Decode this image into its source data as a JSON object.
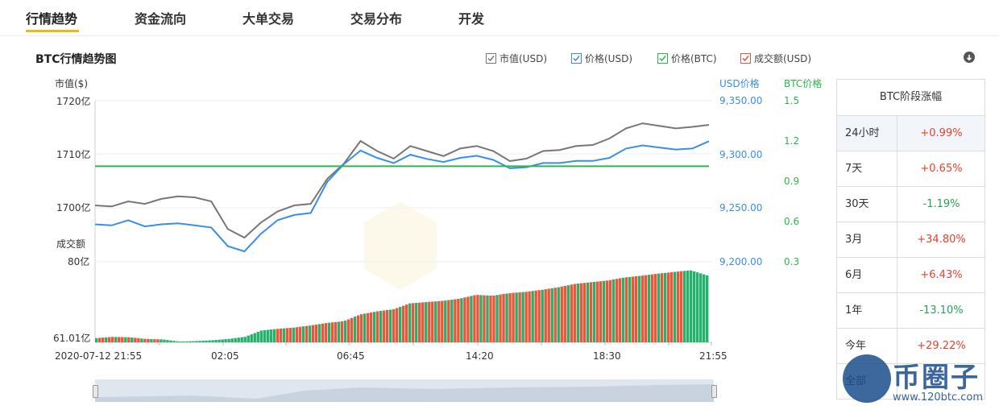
{
  "tabs": [
    {
      "label": "行情趋势",
      "active": true
    },
    {
      "label": "资金流向",
      "active": false
    },
    {
      "label": "大单交易",
      "active": false
    },
    {
      "label": "交易分布",
      "active": false
    },
    {
      "label": "开发",
      "active": false
    }
  ],
  "chart_title": "BTC行情趋势图",
  "legend": [
    {
      "label": "市值(USD)",
      "color": "#777777",
      "checked": true
    },
    {
      "label": "价格(USD)",
      "color": "#3a8ee6",
      "checked": true
    },
    {
      "label": "价格(BTC)",
      "color": "#2ab84a",
      "checked": true
    },
    {
      "label": "成交额(USD)",
      "color": "#e8573a",
      "checked": true
    }
  ],
  "download_icon": "download-icon",
  "axes": {
    "left_label": "市值($)",
    "usd_label": "USD价格",
    "btc_label": "BTC价格",
    "volume_label": "成交额"
  },
  "chart_data": {
    "type": "line",
    "x": [
      "2020-07-12 21:55",
      "02:05",
      "06:45",
      "14:20",
      "18:30",
      "21:55"
    ],
    "x_tick_labels": [
      "2020-07-12 21:55",
      "02:05",
      "06:45",
      "14:20",
      "18:30",
      "21:55"
    ],
    "left_ticks": [
      "1720亿",
      "1710亿",
      "1700亿"
    ],
    "usd_ticks": [
      "9,350.00",
      "9,300.00",
      "9,250.00",
      "9,200.00"
    ],
    "btc_ticks": [
      "1.5",
      "1.2",
      "0.9",
      "0.6",
      "0.3"
    ],
    "volume_ticks": [
      "80亿",
      "61.01亿"
    ],
    "ylim_market_cap": [
      1690,
      1720
    ],
    "ylim_usd": [
      9200,
      9350
    ],
    "ylim_btc": [
      0.3,
      1.5
    ],
    "ylim_volume": [
      61.01,
      80
    ],
    "series": [
      {
        "name": "市值(USD)",
        "color": "#777777",
        "values": [
          1701.2,
          1701.0,
          1702.0,
          1701.5,
          1702.5,
          1703.0,
          1702.8,
          1702.0,
          1696.5,
          1694.8,
          1697.8,
          1700.0,
          1701.2,
          1701.5,
          1706.5,
          1709.5,
          1714.0,
          1712.0,
          1710.5,
          1713.0,
          1712.0,
          1711.0,
          1712.5,
          1713.0,
          1712.0,
          1710.0,
          1710.5,
          1712.0,
          1712.2,
          1713.0,
          1713.2,
          1714.5,
          1716.5,
          1717.5,
          1717.0,
          1716.5,
          1716.8,
          1717.2
        ]
      },
      {
        "name": "价格(USD)",
        "color": "#3a8ee6",
        "values": [
          9231,
          9230,
          9235,
          9229,
          9231,
          9232,
          9230,
          9228,
          9210,
          9205,
          9222,
          9235,
          9240,
          9242,
          9272,
          9289,
          9302,
          9295,
          9290,
          9298,
          9294,
          9291,
          9295,
          9297,
          9293,
          9285,
          9286,
          9290,
          9290,
          9292,
          9292,
          9295,
          9304,
          9307,
          9305,
          9303,
          9304,
          9311
        ]
      },
      {
        "name": "价格(BTC)",
        "color": "#2ab84a",
        "values": [
          1.0,
          1.0,
          1.0,
          1.0,
          1.0,
          1.0,
          1.0,
          1.0,
          1.0,
          1.0,
          1.0,
          1.0,
          1.0,
          1.0,
          1.0,
          1.0,
          1.0,
          1.0,
          1.0,
          1.0,
          1.0,
          1.0,
          1.0,
          1.0,
          1.0,
          1.0,
          1.0,
          1.0,
          1.0,
          1.0,
          1.0,
          1.0,
          1.0,
          1.0,
          1.0,
          1.0,
          1.0,
          1.0
        ]
      },
      {
        "name": "成交额(USD)",
        "color": "#e8573a",
        "values": [
          62.0,
          62.3,
          62.2,
          61.8,
          61.7,
          61.2,
          61.3,
          61.5,
          61.8,
          62.3,
          63.8,
          64.2,
          64.5,
          65.0,
          65.6,
          66.0,
          67.6,
          68.3,
          68.8,
          70.2,
          70.5,
          70.8,
          71.3,
          72.2,
          72.0,
          72.6,
          72.9,
          73.4,
          74.0,
          74.8,
          75.2,
          75.6,
          76.3,
          76.7,
          77.2,
          77.6,
          78.0,
          76.8
        ]
      }
    ]
  },
  "side_panel": {
    "title": "BTC阶段涨幅",
    "rows": [
      {
        "period": "24小时",
        "value": "+0.99%",
        "trend": "up",
        "selected": true
      },
      {
        "period": "7天",
        "value": "+0.65%",
        "trend": "up",
        "selected": false
      },
      {
        "period": "30天",
        "value": "-1.19%",
        "trend": "down",
        "selected": false
      },
      {
        "period": "3月",
        "value": "+34.80%",
        "trend": "up",
        "selected": false
      },
      {
        "period": "6月",
        "value": "+6.43%",
        "trend": "up",
        "selected": false
      },
      {
        "period": "1年",
        "value": "-13.10%",
        "trend": "down",
        "selected": false
      },
      {
        "period": "今年",
        "value": "+29.22%",
        "trend": "up",
        "selected": false
      },
      {
        "period": "全部",
        "value": "",
        "trend": "up",
        "selected": false
      }
    ]
  },
  "watermark": {
    "text": "币圈子",
    "url": "www.120btc.com"
  }
}
